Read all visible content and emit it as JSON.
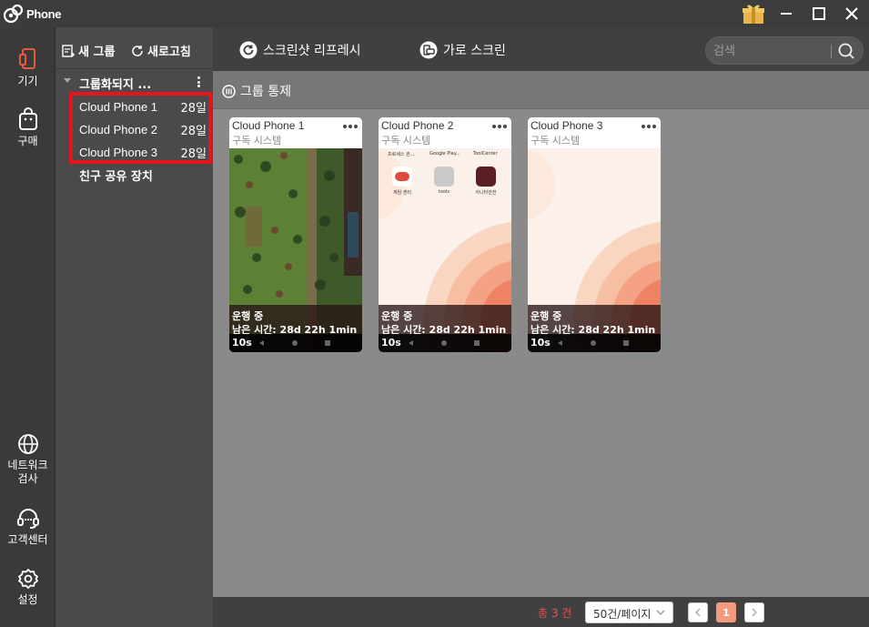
{
  "titlebar": {
    "app_name": "Phone",
    "logo_small": "Pc",
    "icons": [
      "gift-icon",
      "minimize-icon",
      "maximize-icon",
      "close-icon"
    ]
  },
  "leftnav": {
    "items": [
      {
        "label": "기기",
        "icon": "phone-icon",
        "active": true
      },
      {
        "label": "구매",
        "icon": "shopping-bag-icon"
      },
      {
        "label": "네트워크\n검사",
        "icon": "globe-icon"
      },
      {
        "label": "고객센터",
        "icon": "headset-icon"
      },
      {
        "label": "설정",
        "icon": "gear-icon"
      }
    ]
  },
  "grouppanel": {
    "new_group": "새 그룹",
    "refresh": "새로고침",
    "group_name": "그룹화되지 ...",
    "devices": [
      {
        "name": "Cloud Phone 1",
        "days": "28일"
      },
      {
        "name": "Cloud Phone 2",
        "days": "28일"
      },
      {
        "name": "Cloud Phone 3",
        "days": "28일"
      }
    ],
    "friend_shared": "친구 공유 장치"
  },
  "toolbar": {
    "screenshot_refresh": "스크린샷 리프레시",
    "landscape": "가로 스크린",
    "search_placeholder": "검색"
  },
  "subheader": {
    "title": "그룹 통제"
  },
  "cards": [
    {
      "title": "Cloud Phone 1",
      "sub": "구독 시스템",
      "status": "운행 중",
      "remaining": "남은 시간: 28d 22h 1min",
      "remaining_tail": "10s",
      "screen": "game"
    },
    {
      "title": "Cloud Phone 2",
      "sub": "구독 시스템",
      "status": "운행 중",
      "remaining": "남은 시간: 28d 22h 1min",
      "remaining_tail": "10s",
      "screen": "home",
      "top_apps": [
        "프로세스 관...",
        "Google Play...",
        "ToolCenter"
      ],
      "apps": [
        {
          "label": "게임 센터"
        },
        {
          "label": "tools"
        },
        {
          "label": "아니타안전"
        }
      ]
    },
    {
      "title": "Cloud Phone 3",
      "sub": "구독 시스템",
      "status": "운행 중",
      "remaining": "남은 시간: 28d 22h 1min",
      "remaining_tail": "10s",
      "screen": "wallpaper"
    }
  ],
  "footer": {
    "total": "총 3 건",
    "page_size": "50건/페이지",
    "current_page": "1"
  },
  "colors": {
    "highlight": "#e8141c",
    "accent": "#f39a7e",
    "total_text": "#e4544a"
  }
}
